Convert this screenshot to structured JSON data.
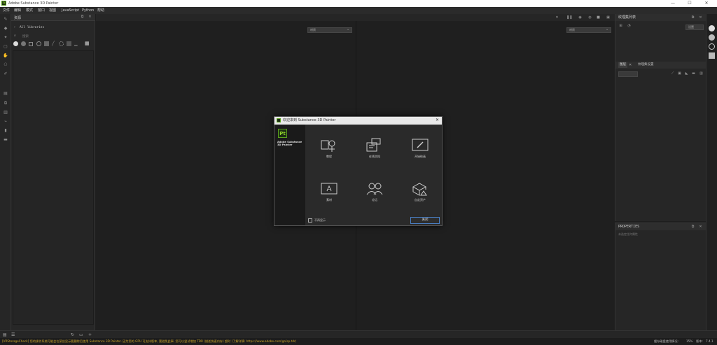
{
  "window": {
    "title": "Adobe Substance 3D Painter",
    "logo": "Pt",
    "controls": [
      "—",
      "☐",
      "✕"
    ]
  },
  "menu": [
    "文件",
    "编辑",
    "模式",
    "窗口",
    "视图",
    "JavaScript",
    "Python",
    "帮助"
  ],
  "assets": {
    "title": "资源",
    "breadcrumb": "All libraries",
    "search_placeholder": "搜索"
  },
  "viewport": {
    "left_dropdown": "材质",
    "right_dropdown": "材质"
  },
  "texture_set": {
    "title": "纹理集列表",
    "dropdown": "设置"
  },
  "layers": {
    "tabs": [
      "图层",
      "纹理集设置"
    ]
  },
  "properties": {
    "title": "PROPERTIES",
    "empty_text": "未选定任何属性"
  },
  "status": {
    "message": "[VRStorageCheck] 您的操作系统可能会在某些显示要删除后使用 Substance 3D Painter. 因为您的 GPU 可支持版本, 要避免此事, 您可以尝试增加 TDR (描述快速内存) 超时 (了解详情: https://www.adobe.com/go/sp-tdr)",
    "cache_label": "缓存磁盘使用情况:",
    "cache_value": "15%",
    "version_label": "版本:",
    "version_value": "7.4.1"
  },
  "dialog": {
    "title": "欢迎来到 Substance 3D Painter",
    "product_logo": "Pt",
    "product_name": "Adobe Substance 3D Painter",
    "tiles": [
      {
        "label": "教程",
        "icon": "tutorial-icon"
      },
      {
        "label": "在线文档",
        "icon": "documentation-icon"
      },
      {
        "label": "开始绘画",
        "icon": "start-painting-icon"
      },
      {
        "label": "素材",
        "icon": "assets-icon"
      },
      {
        "label": "论坛",
        "icon": "forum-icon"
      },
      {
        "label": "自定资产",
        "icon": "custom-assets-icon"
      }
    ],
    "checkbox_label": "不再显示",
    "close_button": "关闭"
  },
  "colors": {
    "accent": "#4a7fc4",
    "brand": "#8fd12b",
    "warning_text": "#c8a42a"
  }
}
